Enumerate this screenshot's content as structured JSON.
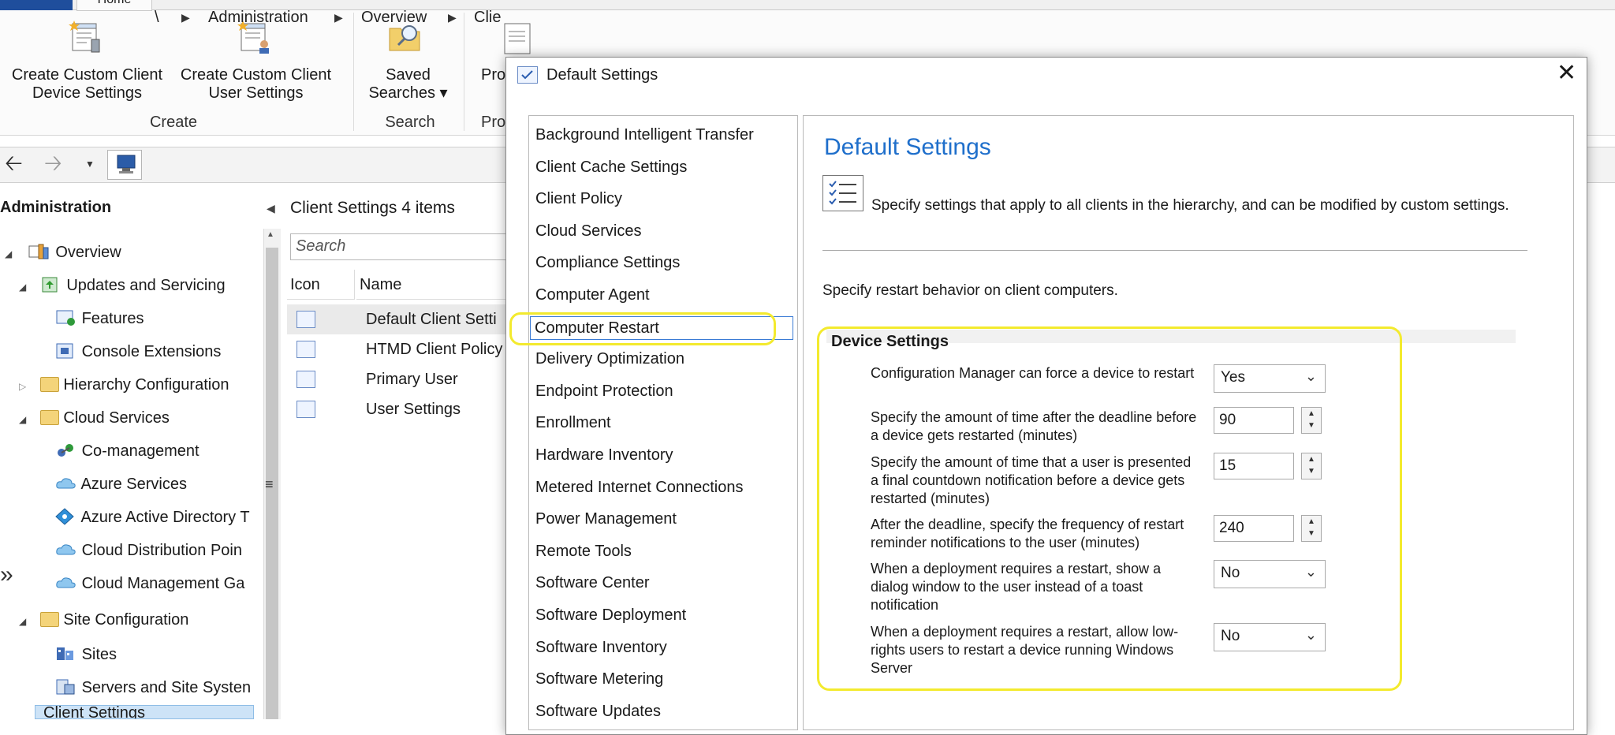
{
  "ribbon": {
    "tab_home": "Home",
    "create_device_label": "Create Custom Client\nDevice Settings",
    "create_user_label": "Create Custom Client\nUser Settings",
    "saved_searches_label": "Saved\nSearches ▾",
    "properties_partial": "Pro",
    "group_create": "Create",
    "group_search": "Search",
    "group_properties_partial": "Pro"
  },
  "address": {
    "root": "\\",
    "crumb1": "Administration",
    "crumb2": "Overview",
    "crumb3_partial": "Clie"
  },
  "nav": {
    "title": "Administration",
    "items": [
      {
        "label": "Overview"
      },
      {
        "label": "Updates and Servicing"
      },
      {
        "label": "Features"
      },
      {
        "label": "Console Extensions"
      },
      {
        "label": "Hierarchy Configuration"
      },
      {
        "label": "Cloud Services"
      },
      {
        "label": "Co-management"
      },
      {
        "label": "Azure Services"
      },
      {
        "label": "Azure Active Directory T"
      },
      {
        "label": "Cloud Distribution Poin"
      },
      {
        "label": "Cloud Management Ga"
      },
      {
        "label": "Site Configuration"
      },
      {
        "label": "Sites"
      },
      {
        "label": "Servers and Site Systen"
      },
      {
        "label": "Client Settings"
      }
    ]
  },
  "list": {
    "header": "Client Settings 4 items",
    "search_placeholder": "Search",
    "col_icon": "Icon",
    "col_name": "Name",
    "rows": [
      {
        "name": "Default Client Setti"
      },
      {
        "name": "HTMD Client Policy"
      },
      {
        "name": "Primary User"
      },
      {
        "name": "User Settings"
      }
    ]
  },
  "dialog": {
    "title": "Default Settings",
    "close_glyph": "✕",
    "categories": [
      "Background Intelligent Transfer",
      "Client Cache Settings",
      "Client Policy",
      "Cloud Services",
      "Compliance Settings",
      "Computer Agent",
      "Computer Restart",
      "Delivery Optimization",
      "Endpoint Protection",
      "Enrollment",
      "Hardware Inventory",
      "Metered Internet Connections",
      "Power Management",
      "Remote Tools",
      "Software Center",
      "Software Deployment",
      "Software Inventory",
      "Software Metering",
      "Software Updates"
    ],
    "selected_category": "Computer Restart",
    "heading": "Default Settings",
    "description": "Specify settings that apply to all clients in the hierarchy, and can be modified by custom settings.",
    "restart_description": "Specify restart behavior on client computers.",
    "section_title": "Device Settings",
    "settings": [
      {
        "label": "Configuration Manager can force a device to restart",
        "value": "Yes"
      },
      {
        "label": "Specify the amount of time after the deadline before a device gets restarted (minutes)",
        "value": "90"
      },
      {
        "label": "Specify the amount of time that a user is presented a final countdown notification before a device gets restarted (minutes)",
        "value": "15"
      },
      {
        "label": "After the deadline, specify the frequency of restart reminder notifications to the user (minutes)",
        "value": "240"
      },
      {
        "label": "When a deployment requires a restart, show a dialog window to the user instead of a toast notification",
        "value": "No"
      },
      {
        "label": "When a deployment requires a restart, allow low-rights users to restart a device running Windows Server",
        "value": "No"
      }
    ]
  },
  "colors": {
    "highlight": "#f3ea2e",
    "heading_blue": "#1f6fcb",
    "selection_border": "#3a7bd5"
  }
}
